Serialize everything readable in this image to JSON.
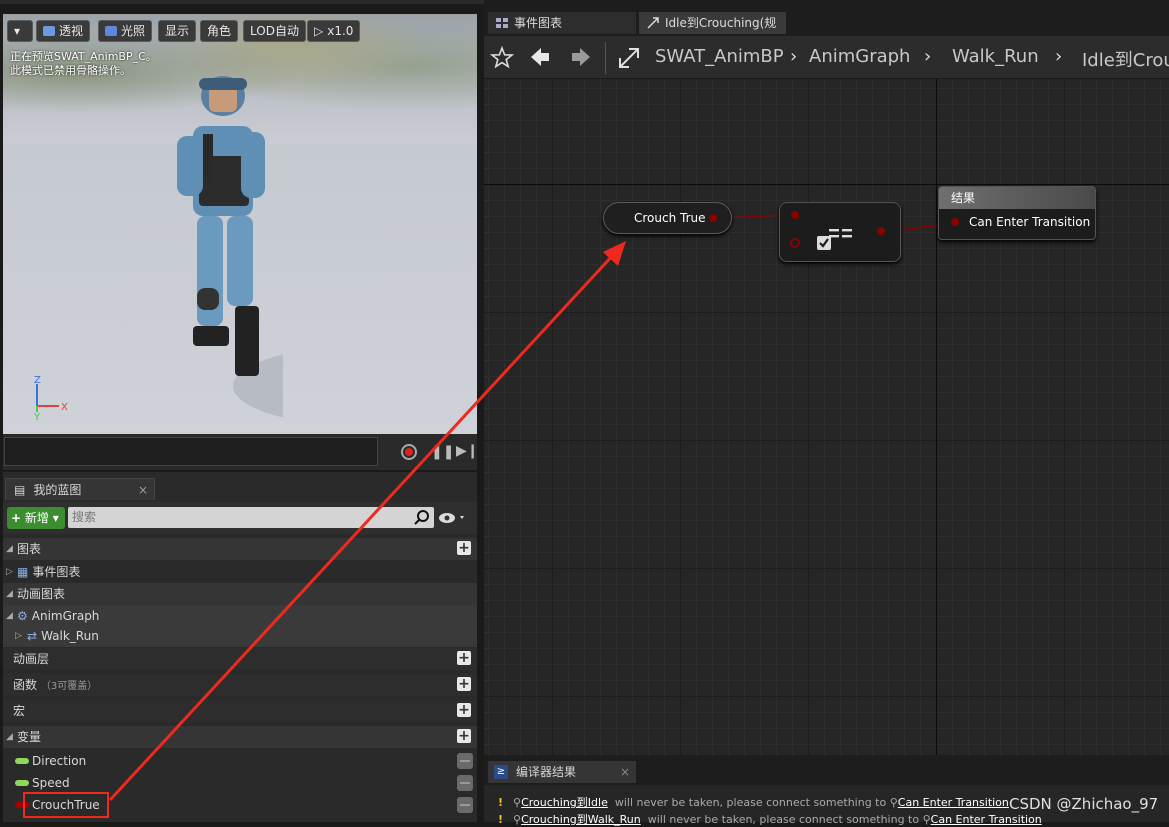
{
  "viewport": {
    "buttons": [
      "透视",
      "光照",
      "显示",
      "角色",
      "LOD自动",
      "x1.0"
    ],
    "notice_line1": "正在预览SWAT_AnimBP_C。",
    "notice_line2": "此模式已禁用骨骼操作。",
    "axis_labels": {
      "z": "Z",
      "y": "Y",
      "x": "X"
    }
  },
  "my_blueprint": {
    "tab_label": "我的蓝图",
    "close_glyph": "×",
    "add_button": "新增",
    "search_placeholder": "搜索",
    "sections": {
      "graphs": "图表",
      "event_graph": "事件图表",
      "anim_graphs": "动画图表",
      "anim_graph": "AnimGraph",
      "walk_run": "Walk_Run",
      "anim_layers": "动画层",
      "functions": "函数",
      "functions_count": "（3可覆盖）",
      "macros": "宏",
      "variables": "变量"
    },
    "variables": [
      {
        "name": "Direction",
        "color": "#8fd85a"
      },
      {
        "name": "Speed",
        "color": "#8fd85a"
      },
      {
        "name": "CrouchTrue",
        "color": "#a80000"
      }
    ]
  },
  "graph_tabs": [
    {
      "label": "事件图表"
    },
    {
      "label": "Idle到Crouching(规"
    }
  ],
  "breadcrumb": [
    "SWAT_AnimBP",
    "AnimGraph",
    "Walk_Run",
    "Idle到Crou"
  ],
  "nodes": {
    "variable": "Crouch True",
    "result_header": "结果",
    "result_pin": "Can Enter Transition"
  },
  "compiler": {
    "tab_label": "编译器结果",
    "close_glyph": "×",
    "messages": [
      {
        "warn": "!",
        "source": "Crouching到Idle",
        "text": "will never be taken, please connect something to",
        "target": "Can Enter Transition"
      },
      {
        "warn": "!",
        "source": "Crouching到Walk_Run",
        "text": "will never be taken, please connect something to",
        "target": "Can Enter Transition"
      }
    ]
  },
  "watermark": "CSDN @Zhichao_97",
  "annotation_color": "#ee2a1e"
}
